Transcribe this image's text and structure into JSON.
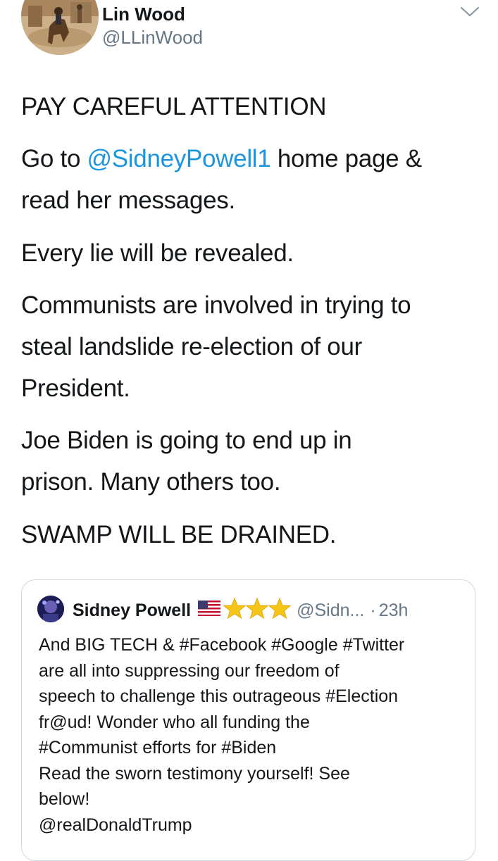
{
  "author": {
    "name": "Lin Wood",
    "handle": "@LLinWood"
  },
  "tweet": {
    "line1": "PAY CAREFUL ATTENTION",
    "p2_before": "Go to ",
    "p2_mention": "@SidneyPowell1",
    "p2_after": " home page &",
    "p2_line2": "read her messages.",
    "p3": "Every lie will be revealed.",
    "p4_line1": "Communists are involved in trying to",
    "p4_line2": "steal landslide re-election of our",
    "p4_line3": "President.",
    "p5_line1": "Joe Biden is going to end up in",
    "p5_line2": "prison. Many others too.",
    "p6": "SWAMP WILL BE DRAINED."
  },
  "quoted": {
    "name": "Sidney Powell",
    "handle": "@Sidn...",
    "separator": "·",
    "time": "23h",
    "lines": [
      "And BIG TECH & #Facebook #Google #Twitter",
      "are all into suppressing our freedom of",
      "speech to challenge this outrageous #Election",
      "fr@ud! Wonder who all funding the",
      "#Communist efforts for #Biden",
      "Read the sworn testimony yourself! See",
      "below!",
      "@realDonaldTrump"
    ]
  },
  "icons": {
    "caret": "chevron-down-icon",
    "flag": "us-flag-icon",
    "star": "star-icon"
  },
  "colors": {
    "link": "#1b95e0",
    "text": "#14171a",
    "secondary": "#657786",
    "border": "#cfd9de",
    "star": "#f5c518"
  }
}
